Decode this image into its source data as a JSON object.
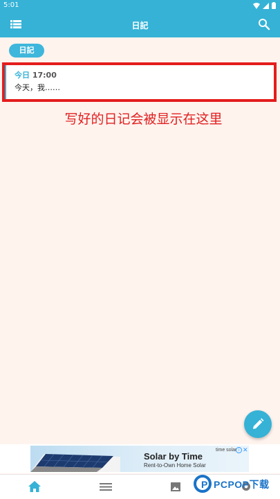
{
  "status_bar": {
    "time": "5:01"
  },
  "app_bar": {
    "title": "日記",
    "menu_icon": "list-icon",
    "search_icon": "search-icon"
  },
  "chip": {
    "label": "日記"
  },
  "entry": {
    "day": "今日",
    "time": "17:00",
    "text": "今天，我……"
  },
  "annotation": {
    "text": "写好的日记会被显示在这里"
  },
  "fab": {
    "icon": "pencil-icon"
  },
  "ad": {
    "title": "Solar by Time",
    "subtitle": "Rent-to-Own Home Solar",
    "brand": "time solar",
    "close": "✕",
    "info": "i"
  },
  "bottom_nav": {
    "items": [
      "home-icon",
      "menu-icon",
      "image-icon",
      "settings-icon"
    ]
  },
  "watermark": {
    "letter": "P",
    "text": "PCPOP下载"
  },
  "colors": {
    "primary": "#35b2d6",
    "background": "#fff3ee",
    "annotation_red": "#e02020",
    "highlight_red": "#e41d1d"
  }
}
